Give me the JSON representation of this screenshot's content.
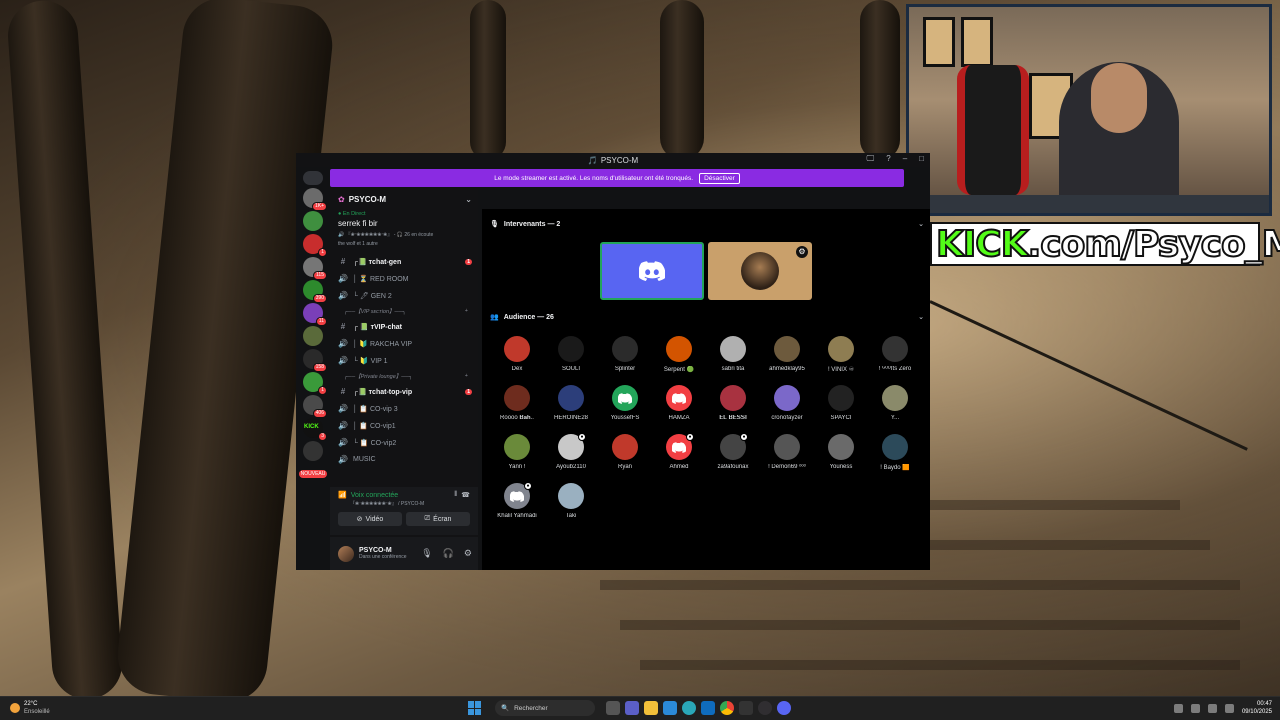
{
  "overlay": {
    "kick_logo": "KICK",
    "kick_url": ".com/Psyco_M"
  },
  "window": {
    "title": "PSYCO-M",
    "controls": [
      "🖵",
      "?",
      "–",
      "□"
    ]
  },
  "streamer_mode": {
    "text": "Le mode streamer est activé. Les noms d'utilisateur ont été tronqués.",
    "button": "Désactiver"
  },
  "servers": [
    {
      "badge": "1K+",
      "color": "#6b6b6b"
    },
    {
      "badge": "",
      "color": "#3f8f3f"
    },
    {
      "badge": "1",
      "color": "#c82d2d"
    },
    {
      "badge": "115",
      "color": "#767676"
    },
    {
      "badge": "390",
      "color": "#2d8a2d"
    },
    {
      "badge": "11",
      "color": "#7a3fb8"
    },
    {
      "badge": "",
      "color": "#5a6a3a"
    },
    {
      "badge": "158",
      "color": "#2a2a2a"
    },
    {
      "badge": "1",
      "color": "#3a9a3a"
    },
    {
      "badge": "406",
      "color": "#4a4a4a"
    },
    {
      "badge": "3",
      "color": "#111111"
    },
    {
      "badge": "",
      "color": "#333333"
    }
  ],
  "server_new": "NOUVEAU",
  "server_kick_label": "KICK",
  "sidebar": {
    "server_name": "PSYCO-M",
    "event": {
      "live": "● En Direct",
      "name": "serrek fi bir",
      "meta1": "🔊 『❀‧❀❀❀❀❀❀‧❀』 - 🎧 26 en écoute",
      "meta2": "the wolf et 1 autre"
    },
    "items": [
      {
        "type": "text",
        "icon": "#",
        "label": "┌📗 ᴛchat-gen",
        "active": true,
        "unread": "1"
      },
      {
        "type": "voice",
        "icon": "🔊",
        "label": "│ ⏳ RED ROOM"
      },
      {
        "type": "voice",
        "icon": "🔊",
        "label": "└ 🖊 GEN 2"
      },
      {
        "type": "category",
        "label": "╭──【VIP sᴇcᴛion】──╮"
      },
      {
        "type": "text",
        "icon": "#",
        "label": "┌ 📗 ᴛVIP-chat",
        "active": true
      },
      {
        "type": "voice",
        "icon": "🔊",
        "label": "│ 🔰 RAKCHA VIP"
      },
      {
        "type": "voice",
        "icon": "🔊",
        "label": "└ 🔰 VIP 1"
      },
      {
        "type": "category",
        "label": "╭──【Private lounge】──╮"
      },
      {
        "type": "text",
        "icon": "#",
        "label": "┌📗 ᴛchat-top-vip",
        "active": true,
        "unread": "1"
      },
      {
        "type": "voice",
        "icon": "🔊",
        "label": "│ 📋 CO-vip 3"
      },
      {
        "type": "voice",
        "icon": "🔊",
        "label": "│ 📋 CO-vip1"
      },
      {
        "type": "voice",
        "icon": "🔊",
        "label": "└ 📋 CO-vip2"
      },
      {
        "type": "voice",
        "icon": "🔊",
        "label": "MUSIC"
      }
    ]
  },
  "voice_panel": {
    "status": "Voix connectée",
    "channel": "『❀‧❀❀❀❀❀❀‧❀』 / PSYCO-M",
    "video": "Vidéo",
    "screen": "Écran"
  },
  "user": {
    "name": "PSYCO-M",
    "status": "Dans une conférence"
  },
  "stage": {
    "speakers_title": "Intervenants — 2",
    "audience_title": "Audience — 26",
    "audience": [
      {
        "name": "Dex",
        "color": "#c0392b"
      },
      {
        "name": "SOULI",
        "color": "#1a1a1a"
      },
      {
        "name": "Splinter",
        "color": "#2b2b2b"
      },
      {
        "name": "Serpent 🟢",
        "color": "#d35400"
      },
      {
        "name": "sabri tita",
        "color": "#b0b0b0"
      },
      {
        "name": "ahmedklay95",
        "color": "#6d5a3d"
      },
      {
        "name": "! VINIX ♾",
        "color": "#8e7d52"
      },
      {
        "name": "! ᴳᴼᴰIts Zero",
        "color": "#333333"
      },
      {
        "name": "Rᴏᴏᴏᴏ 𝐁𝐚𝐡..",
        "color": "#6e2c1e"
      },
      {
        "name": "HEROINE28",
        "color": "#2c3e7a"
      },
      {
        "name": "YoussefFS",
        "color": "#23a55a",
        "discord": true
      },
      {
        "name": "HAMZA",
        "color": "#f23f43",
        "discord": true
      },
      {
        "name": "𝐄𝐋 𝐁𝐄𝐒𝐒𝐈",
        "color": "#a83240"
      },
      {
        "name": "cronofayzer",
        "color": "#7b68c9"
      },
      {
        "name": "SPAYCI",
        "color": "#222222"
      },
      {
        "name": "Y...",
        "color": "#8a8a6a"
      },
      {
        "name": "Yann !",
        "color": "#6a8a3a"
      },
      {
        "name": "Ayoub2110",
        "color": "#c8c8c8",
        "mark": true
      },
      {
        "name": "Ryan",
        "color": "#c0392b"
      },
      {
        "name": "Ahmed",
        "color": "#f23f43",
        "discord": true,
        "mark": true
      },
      {
        "name": "za9afounax",
        "color": "#444444",
        "mark": true
      },
      {
        "name": "! Demon69 ᵒᵒᵒ",
        "color": "#555555"
      },
      {
        "name": "Youness",
        "color": "#6a6a6a"
      },
      {
        "name": "! Baydo 🟧",
        "color": "#2c4a5a"
      },
      {
        "name": "Khalil Yahmadi",
        "color": "#80848e",
        "discord": true,
        "mark": true
      },
      {
        "name": "Taki",
        "color": "#9ab0c0"
      }
    ]
  },
  "taskbar": {
    "weather_temp": "22°C",
    "weather_desc": "Ensoleillé",
    "search": "Rechercher",
    "time": "00:47",
    "date": "09/10/2025"
  }
}
